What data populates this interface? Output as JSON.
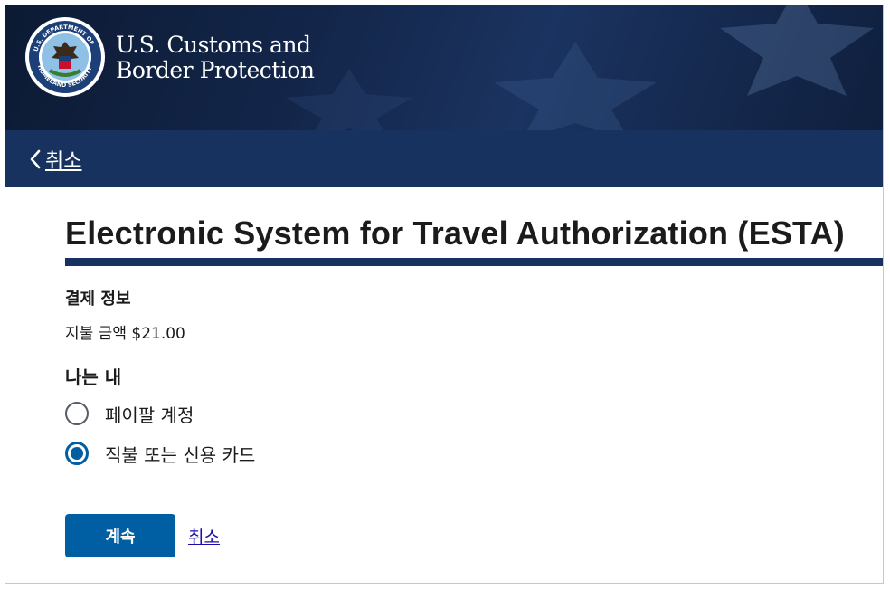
{
  "header": {
    "agency_line1": "U.S. Customs and",
    "agency_line2": "Border Protection",
    "seal_icon": "dhs-seal-icon",
    "seal_text": "U.S. DEPARTMENT OF HOMELAND SECURITY"
  },
  "nav": {
    "back_label": "취소",
    "back_icon": "chevron-left-icon"
  },
  "main": {
    "title": "Electronic System for Travel Authorization (ESTA)",
    "section_label": "결제 정보",
    "amount_label": "지불 금액",
    "amount_value": "$21.00",
    "method_label": "나는 내",
    "options": [
      {
        "label": "페이팔 계정",
        "selected": false
      },
      {
        "label": "직불 또는 신용 카드",
        "selected": true
      }
    ]
  },
  "actions": {
    "continue_label": "계속",
    "cancel_label": "취소"
  },
  "colors": {
    "header_bg": "#13264a",
    "navbar_bg": "#17325f",
    "primary": "#005ea2",
    "link": "#1a0dab"
  }
}
